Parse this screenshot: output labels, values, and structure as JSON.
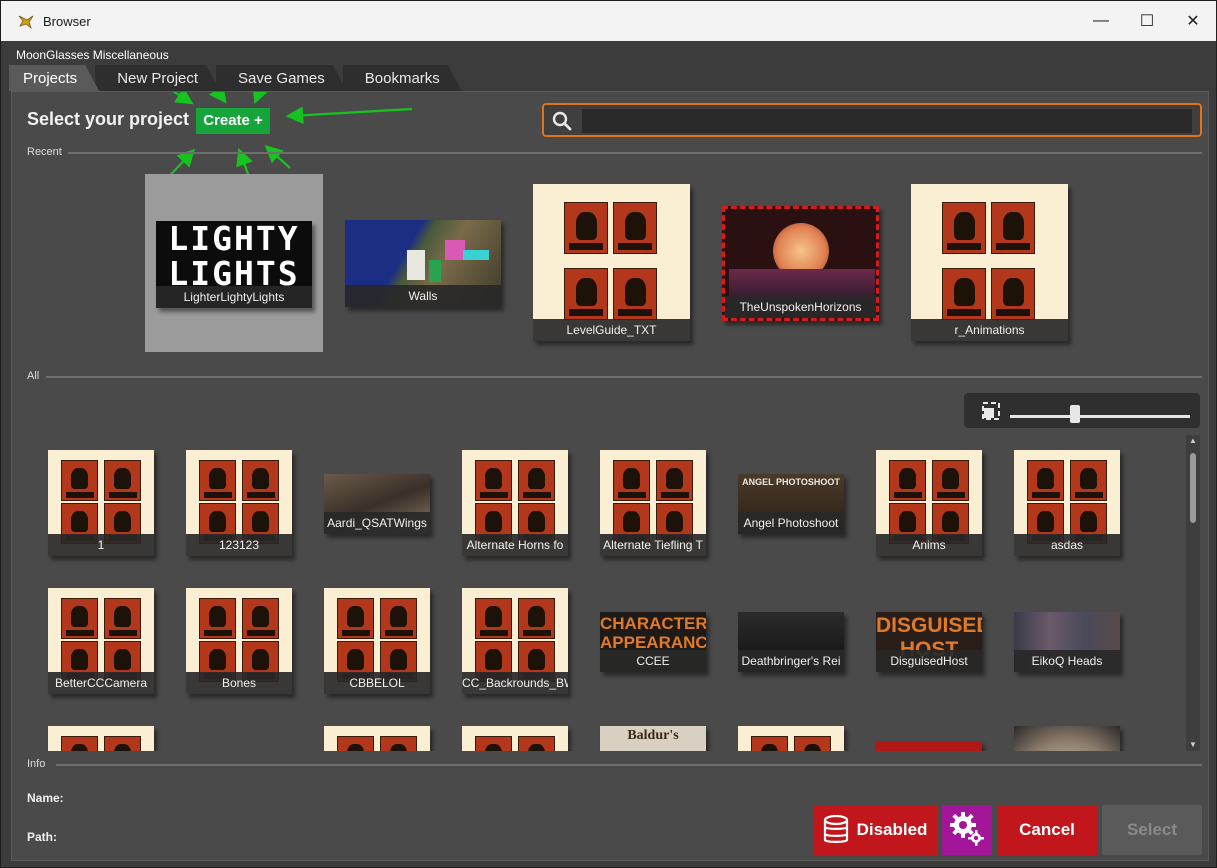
{
  "window": {
    "title": "Browser",
    "subtitle": "MoonGlasses Miscellaneous",
    "min_glyph": "—",
    "max_glyph": "☐",
    "close_glyph": "✕"
  },
  "tabs": [
    {
      "label": "Projects",
      "active": true
    },
    {
      "label": "New Project"
    },
    {
      "label": "Save Games"
    },
    {
      "label": "Bookmarks"
    }
  ],
  "header": {
    "select_label": "Select your project",
    "create_label": "Create +",
    "search_placeholder": ""
  },
  "sections": {
    "recent": "Recent",
    "all": "All",
    "info": "Info"
  },
  "recent": [
    {
      "label": "LighterLightyLights",
      "kind": "lighty",
      "selected": true
    },
    {
      "label": "Walls",
      "kind": "walls"
    },
    {
      "label": "LevelGuide_TXT",
      "kind": "larian"
    },
    {
      "label": "TheUnspokenHorizons",
      "kind": "horizons"
    },
    {
      "label": "r_Animations",
      "kind": "larian"
    }
  ],
  "all": [
    {
      "label": "1",
      "kind": "larian"
    },
    {
      "label": "123123",
      "kind": "larian"
    },
    {
      "label": "Aardi_QSATWings",
      "kind": "photo"
    },
    {
      "label": "Alternate Horns fo",
      "kind": "larian"
    },
    {
      "label": "Alternate Tiefling T",
      "kind": "larian"
    },
    {
      "label": "Angel Photoshoot",
      "kind": "angel",
      "banner": "ANGEL PHOTOSHOOT"
    },
    {
      "label": "Anims",
      "kind": "larian"
    },
    {
      "label": "asdas",
      "kind": "larian"
    },
    {
      "label": "BetterCCCamera",
      "kind": "larian"
    },
    {
      "label": "Bones",
      "kind": "larian"
    },
    {
      "label": "CBBELOL",
      "kind": "larian"
    },
    {
      "label": "CC_Backrounds_BW",
      "kind": "larian"
    },
    {
      "label": "CCEE",
      "kind": "ccee",
      "banner": "CHARACTER APPEARANCE"
    },
    {
      "label": "Deathbringer's Rei",
      "kind": "deathbringer"
    },
    {
      "label": "DisguisedHost",
      "kind": "disguised",
      "banner": "DISGUISED HOST"
    },
    {
      "label": "EikoQ Heads",
      "kind": "eikoq"
    },
    {
      "label": "",
      "kind": "larian"
    },
    {
      "label": "",
      "kind": "dark"
    },
    {
      "label": "",
      "kind": "larian"
    },
    {
      "label": "",
      "kind": "larian"
    },
    {
      "label": "",
      "kind": "baldurs",
      "banner": "Baldur's"
    },
    {
      "label": "",
      "kind": "larian"
    },
    {
      "label": "",
      "kind": "red"
    },
    {
      "label": "",
      "kind": "hair"
    }
  ],
  "thumbnail_text": {
    "lighty_banner": "LIGHTY LIGHTS"
  },
  "zoom": {
    "level": 0.36
  },
  "info": {
    "name_label": "Name:",
    "path_label": "Path:"
  },
  "buttons": {
    "disabled": "Disabled",
    "cancel": "Cancel",
    "select": "Select"
  },
  "colors": {
    "accent_orange": "#e0731e",
    "create_green": "#16a53a",
    "danger_red": "#c0161c",
    "gear_purple": "#a3169a"
  }
}
